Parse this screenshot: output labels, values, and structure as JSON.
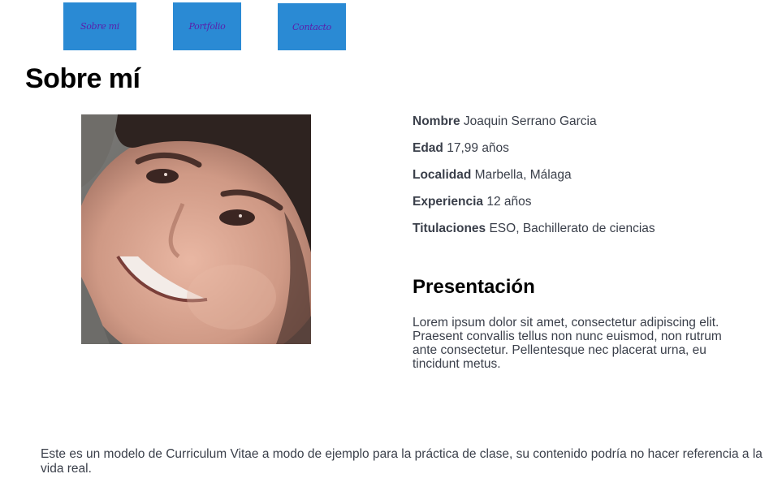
{
  "nav": {
    "items": [
      {
        "label": "Sobre mi"
      },
      {
        "label": "Portfolio"
      },
      {
        "label": "Contacto"
      }
    ],
    "color": "#2a8ad4",
    "text_color": "#5a1faa"
  },
  "page_title": "Sobre mí",
  "profile": {
    "photo": "profile-photo",
    "fields": [
      {
        "label": "Nombre",
        "value": "Joaquin Serrano Garcia"
      },
      {
        "label": "Edad",
        "value": "17,99 años"
      },
      {
        "label": "Localidad",
        "value": "Marbella, Málaga"
      },
      {
        "label": "Experiencia",
        "value": "12 años"
      },
      {
        "label": "Titulaciones",
        "value": "ESO, Bachillerato de ciencias"
      }
    ]
  },
  "presentation": {
    "title": "Presentación",
    "text": "Lorem ipsum dolor sit amet, consectetur adipiscing elit. Praesent convallis tellus non nunc euismod, non rutrum ante consectetur. Pellentesque nec placerat urna, eu tincidunt metus."
  },
  "footer": {
    "text": "Este es un modelo de Curriculum Vitae a modo de ejemplo para la práctica de clase, su contenido podría no hacer referencia a la vida real."
  }
}
